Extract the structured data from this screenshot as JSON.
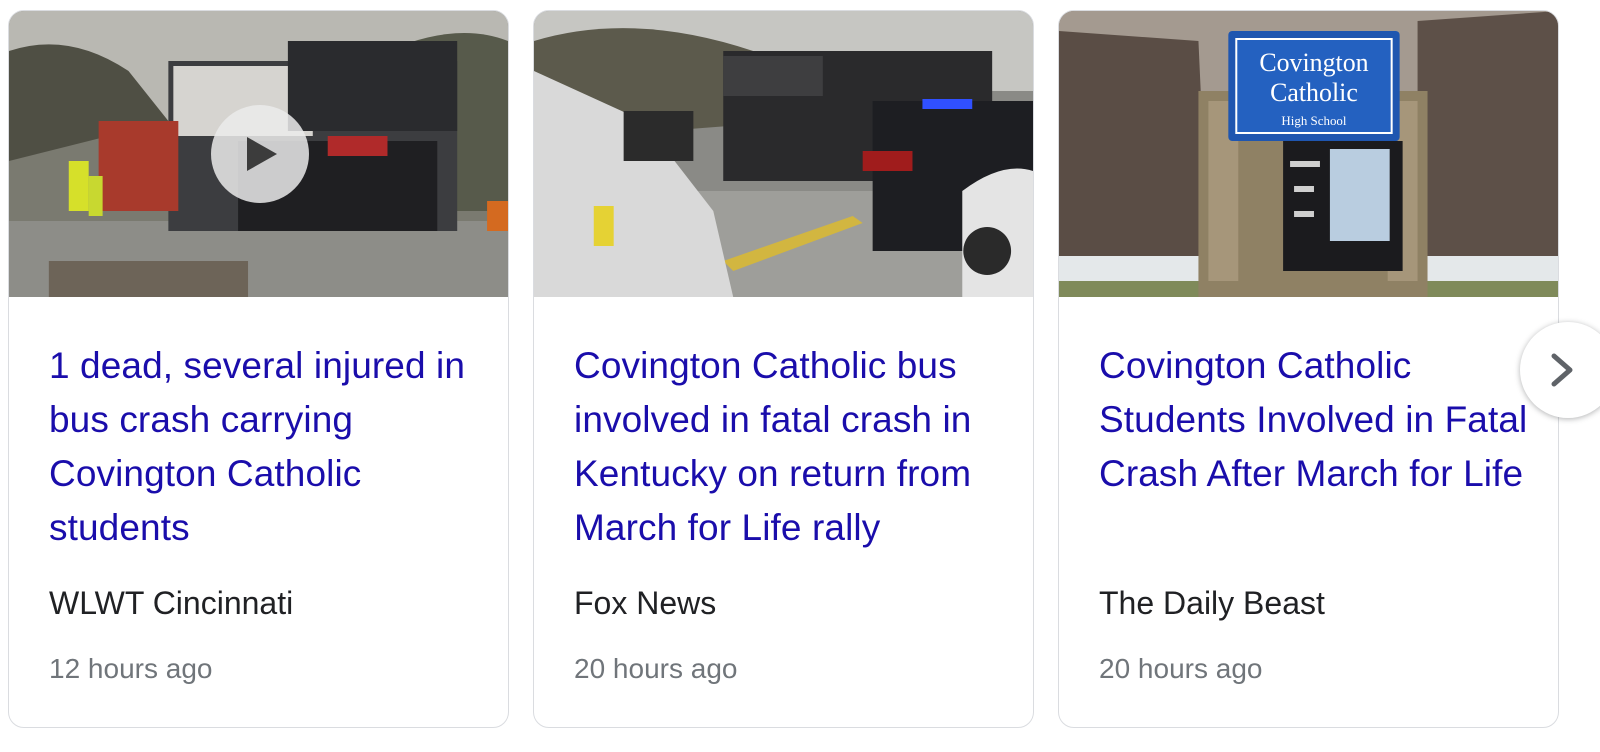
{
  "cards": [
    {
      "headline": "1 dead, several injured in bus crash carrying Covington Catholic students",
      "source": "WLWT Cincinnati",
      "time": "12 hours ago",
      "thumbnail": "bus-crash-scene-video",
      "has_video": true
    },
    {
      "headline": "Covington Catholic bus involved in fatal crash in Kentucky on return from March for Life rally",
      "source": "Fox News",
      "time": "20 hours ago",
      "thumbnail": "police-cars-highway"
    },
    {
      "headline": "Covington Catholic Students Involved in Fatal Crash After March for Life",
      "source": "The Daily Beast",
      "time": "20 hours ago",
      "thumbnail": "school-sign",
      "sign_text": [
        "Covington",
        "Catholic",
        "High School"
      ]
    }
  ],
  "colors": {
    "link": "#1a0dab",
    "source": "#202124",
    "time": "#70757a",
    "border": "#dadce0"
  },
  "icons": {
    "play": "play-icon",
    "next": "chevron-right-icon"
  }
}
